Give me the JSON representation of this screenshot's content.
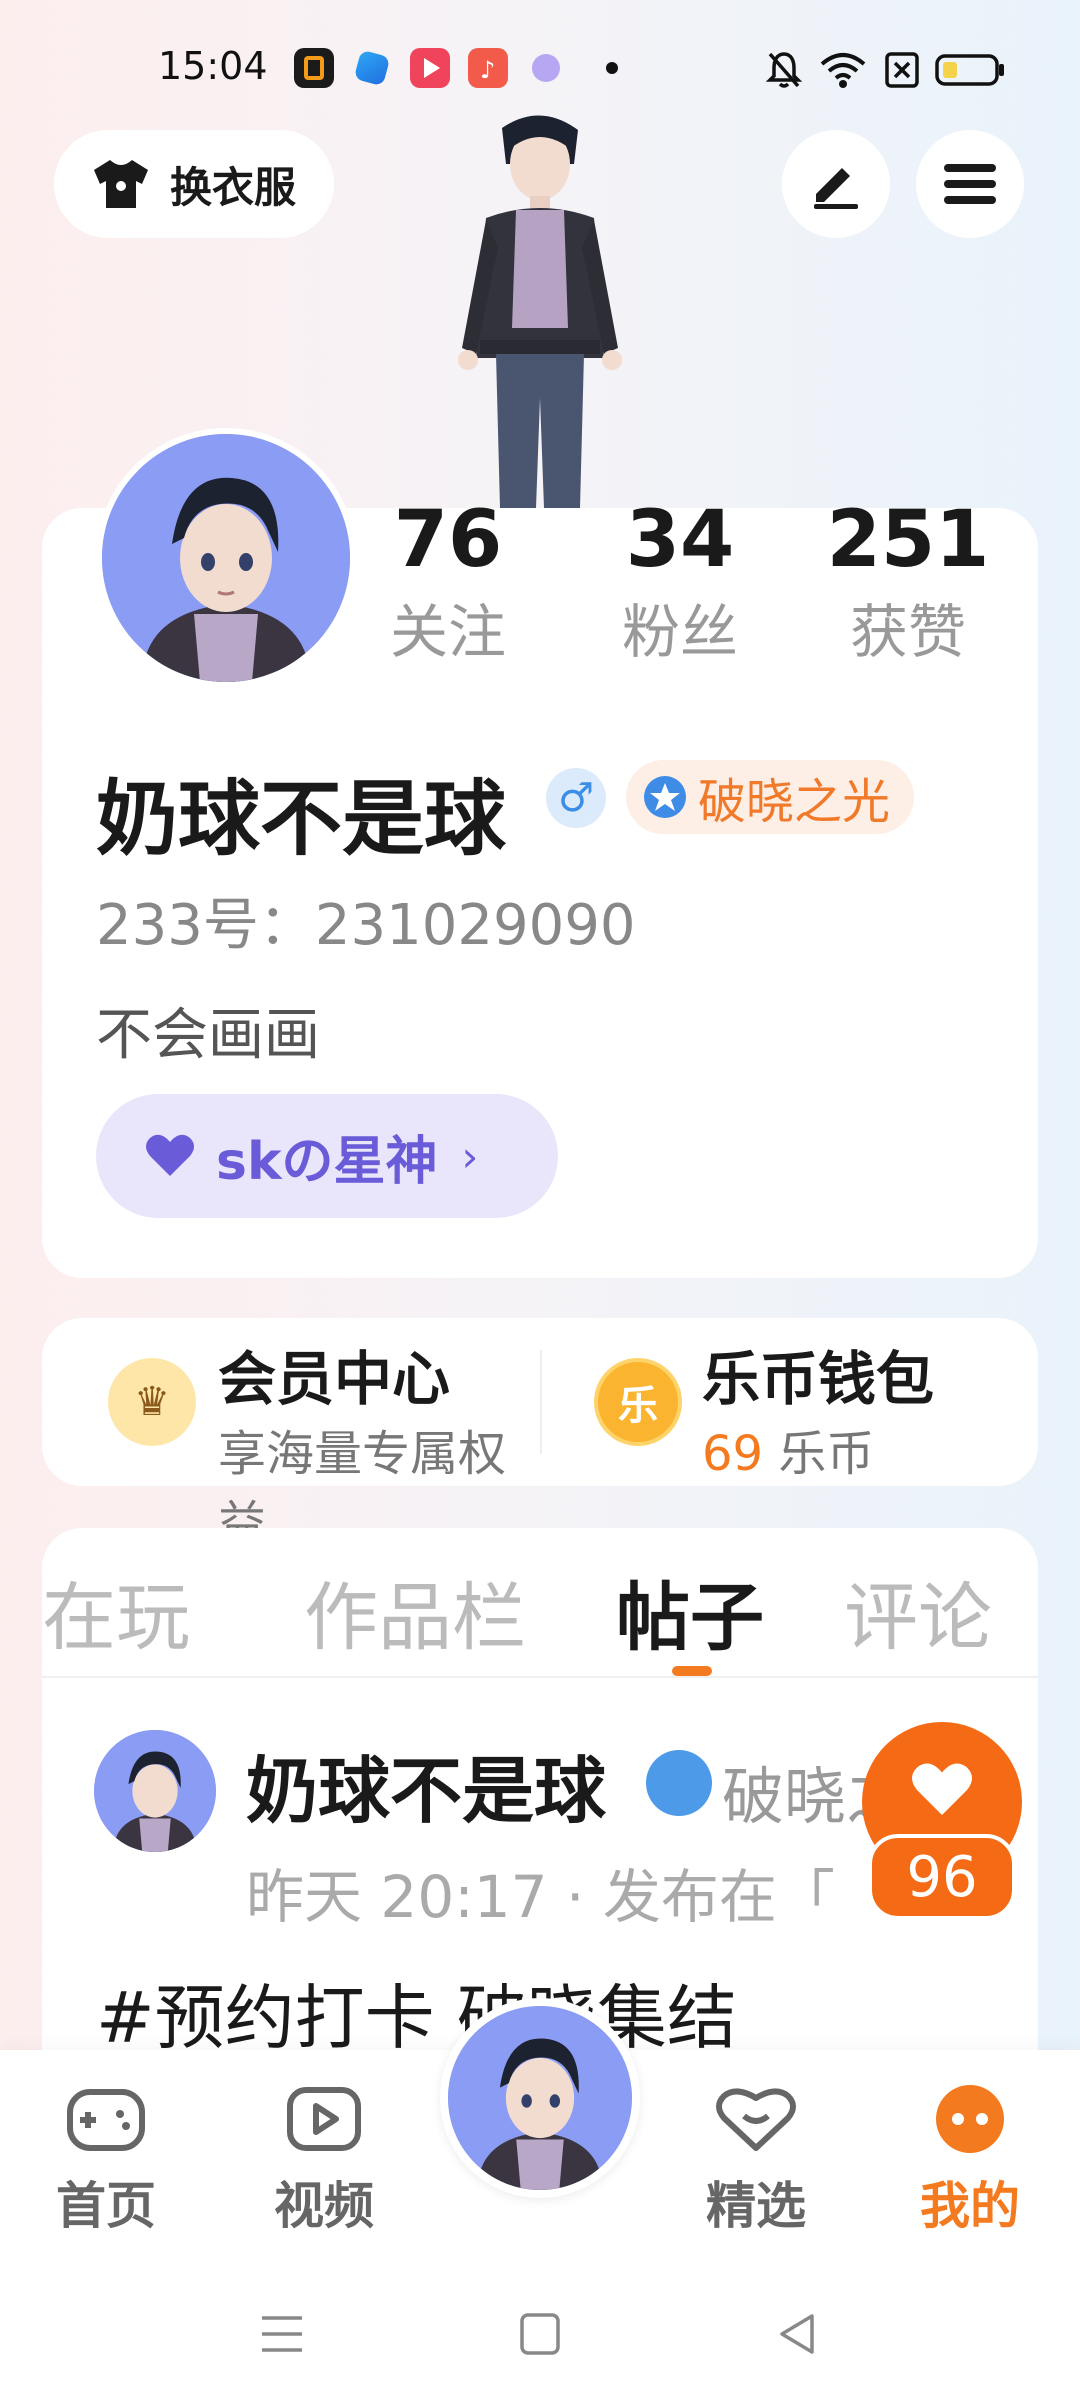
{
  "status_bar": {
    "time": "15:04"
  },
  "header": {
    "wardrobe_label": "换衣服"
  },
  "profile": {
    "stats": [
      {
        "value": "76",
        "label": "关注"
      },
      {
        "value": "34",
        "label": "粉丝"
      },
      {
        "value": "251",
        "label": "获赞"
      }
    ],
    "username": "奶球不是球",
    "gender_symbol": "♂",
    "title_badge": "破晓之光",
    "account_id": "233号：231029090",
    "bio": "不会画画",
    "group_name": "skの星神",
    "group_chevron": "›"
  },
  "services": {
    "member": {
      "title": "会员中心",
      "subtitle": "享海量专属权益",
      "icon_text": "♛"
    },
    "wallet": {
      "title": "乐币钱包",
      "amount": "69",
      "unit": "乐币",
      "icon_text": "乐"
    }
  },
  "tabs": [
    {
      "label": "正在玩"
    },
    {
      "label": "作品栏"
    },
    {
      "label": "帖子"
    },
    {
      "label": "评论"
    }
  ],
  "post": {
    "author": "奶球不是球",
    "badge_text": "破晓之光",
    "meta": "昨天 20:17 · 发布在「",
    "title": "#预约打卡 破晓集结"
  },
  "float_like": {
    "count": "96"
  },
  "bottom_nav": [
    {
      "label": "首页",
      "icon": "gamepad-icon"
    },
    {
      "label": "视频",
      "icon": "video-icon"
    },
    {
      "label": "精选",
      "icon": "heart-chat-icon"
    },
    {
      "label": "我的",
      "icon": "me-icon"
    }
  ],
  "colors": {
    "accent": "#f47a20",
    "group_purple": "#6a5bd8",
    "badge_orange": "#f07a2a"
  }
}
